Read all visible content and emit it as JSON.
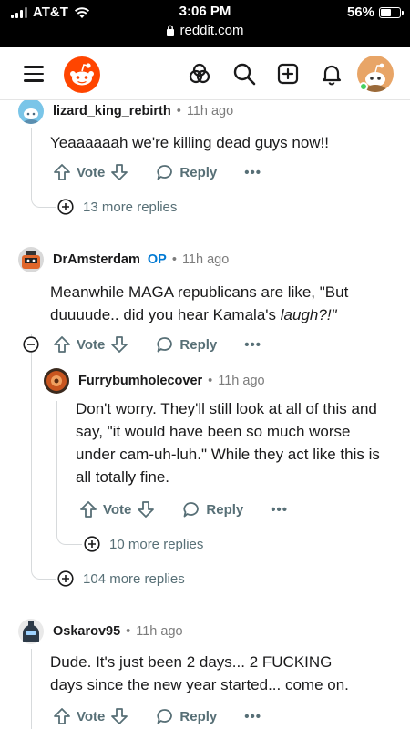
{
  "status": {
    "carrier": "AT&T",
    "time": "3:06 PM",
    "url": "reddit.com",
    "battery": "56%",
    "battery_level": 0.56
  },
  "header": {
    "icons": [
      "menu-icon",
      "reddit-logo",
      "community-icon",
      "search-icon",
      "create-post-icon",
      "notification-bell-icon",
      "user-avatar"
    ]
  },
  "comments": [
    {
      "user": "lizard_king_rebirth",
      "dot": "•",
      "time": "11h ago",
      "body": "Yeaaaaaah we're killing dead guys now!!",
      "vote": "Vote",
      "reply": "Reply",
      "more": "•••",
      "more_replies": "13 more replies"
    },
    {
      "user": "DrAmsterdam",
      "op": "OP",
      "dot": "•",
      "time": "11h ago",
      "body_start": "Meanwhile MAGA republicans are like, \"But duuuude.. did you hear Kamala's ",
      "body_em": "laugh?!\"",
      "vote": "Vote",
      "reply": "Reply",
      "more": "•••",
      "more_replies": "104 more replies"
    },
    {
      "user": "Furrybumholecover",
      "dot": "•",
      "time": "11h ago",
      "body": "Don't worry. They'll still look at all of this and say, \"it would have been so much worse under cam-uh-luh.\" While they act like this is all totally fine.",
      "vote": "Vote",
      "reply": "Reply",
      "more": "•••",
      "more_replies": "10 more replies"
    },
    {
      "user": "Oskarov95",
      "dot": "•",
      "time": "11h ago",
      "body": "Dude. It's just been 2 days... 2 FUCKING days since the new year started... come on.",
      "vote": "Vote",
      "reply": "Reply",
      "more": "•••"
    }
  ],
  "colors": {
    "reddit_orange": "#ff4500",
    "op_blue": "#0079d3",
    "meta_gray": "#576f76",
    "thread_line": "#d7dadc",
    "online_green": "#46d160"
  }
}
